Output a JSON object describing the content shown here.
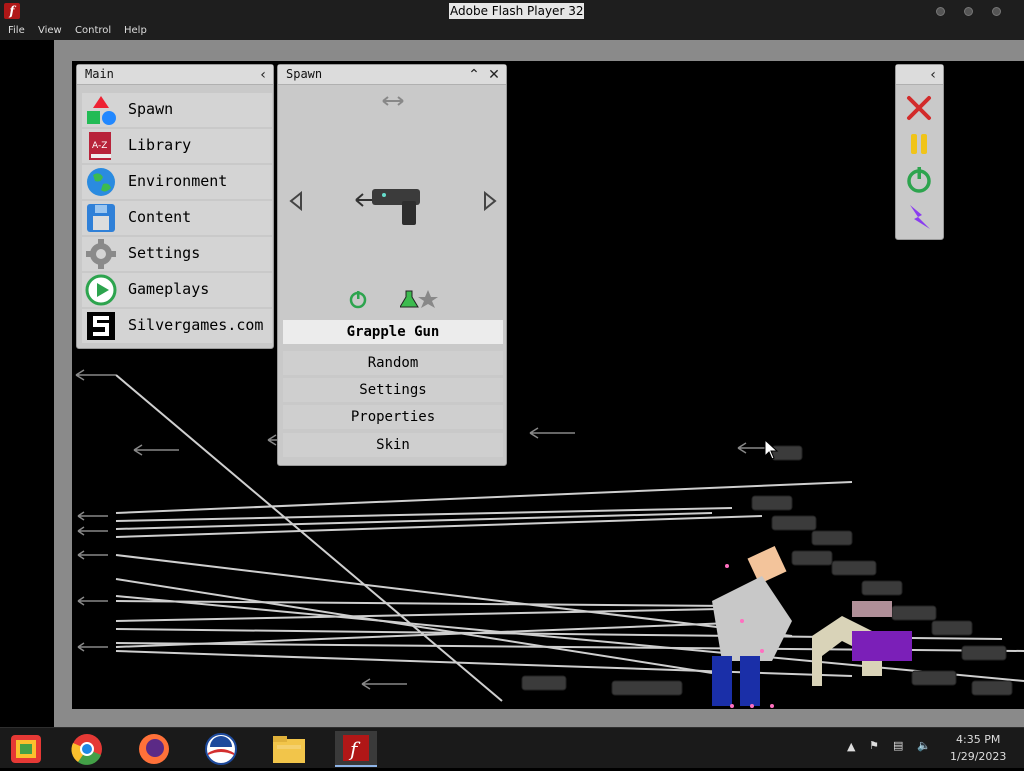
{
  "window": {
    "title": "Adobe Flash Player 32"
  },
  "menu": [
    "File",
    "View",
    "Control",
    "Help"
  ],
  "main_panel": {
    "title": "Main",
    "items": [
      {
        "label": "Spawn",
        "icon": "spawn-shapes-icon"
      },
      {
        "label": "Library",
        "icon": "library-book-icon"
      },
      {
        "label": "Environment",
        "icon": "globe-icon"
      },
      {
        "label": "Content",
        "icon": "floppy-disk-icon"
      },
      {
        "label": "Settings",
        "icon": "gear-icon"
      },
      {
        "label": "Gameplays",
        "icon": "play-icon"
      },
      {
        "label": "Silvergames.com",
        "icon": "silvergames-logo-icon"
      }
    ]
  },
  "spawn_panel": {
    "title": "Spawn",
    "selected_item": "Grapple Gun",
    "options": [
      "Random",
      "Settings",
      "Properties",
      "Skin"
    ]
  },
  "toolbox": [
    "close-x-icon",
    "pause-icon",
    "power-icon",
    "lightning-icon"
  ],
  "taskbar": {
    "apps": [
      "chrome-remote-desktop-icon",
      "chrome-icon",
      "firefox-icon",
      "obama-logo-icon",
      "file-explorer-icon",
      "flash-player-icon"
    ],
    "time": "4:35 PM",
    "date": "1/29/2023"
  },
  "colors": {
    "panel_bg": "#c9c9c9",
    "stage_bg": "#000000",
    "frame": "#8a8a8a",
    "accent_red": "#d22b2b",
    "accent_green": "#2da44e",
    "accent_yellow": "#f0c419",
    "accent_purple": "#8a3cf0"
  }
}
